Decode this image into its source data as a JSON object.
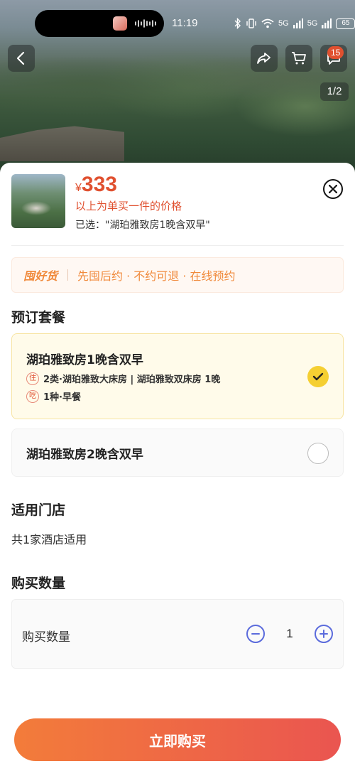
{
  "status_bar": {
    "time": "11:19",
    "battery": "65",
    "network_1": "5G",
    "network_2": "5G"
  },
  "hero": {
    "badge_count": "15",
    "page_indicator": "1/2"
  },
  "product": {
    "currency": "¥",
    "price": "333",
    "price_note": "以上为单买一件的价格",
    "selected_text": "已选：\"湖珀雅致房1晚含双早\""
  },
  "promo": {
    "brand": "囤好货",
    "text": "先囤后约 · 不约可退 · 在线预约"
  },
  "packages": {
    "title": "预订套餐",
    "items": [
      {
        "title": "湖珀雅致房1晚含双早",
        "selected": true,
        "rows": [
          {
            "tag": "住",
            "text": "2类·湖珀雅致大床房 | 湖珀雅致双床房 1晚"
          },
          {
            "tag": "吃",
            "text": "1种·早餐"
          }
        ]
      },
      {
        "title": "湖珀雅致房2晚含双早",
        "selected": false
      }
    ]
  },
  "stores": {
    "title": "适用门店",
    "text": "共1家酒店适用"
  },
  "quantity": {
    "title": "购买数量",
    "label": "购买数量",
    "value": "1"
  },
  "buy_button": "立即购买",
  "colors": {
    "price": "#e0502f",
    "promo": "#f08a3c",
    "selected_bg": "#fffbea",
    "check": "#f5cf32",
    "stepper": "#5b6bdc",
    "buy_start": "#f37c3a",
    "buy_end": "#ea5550"
  },
  "icons": [
    "back-arrow-icon",
    "share-icon",
    "cart-icon",
    "message-icon",
    "close-icon",
    "check-icon",
    "minus-icon",
    "plus-icon"
  ]
}
